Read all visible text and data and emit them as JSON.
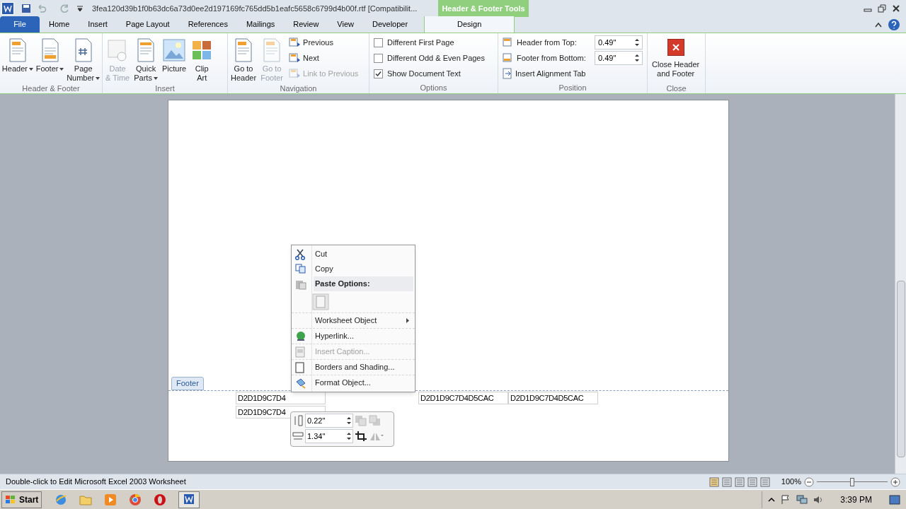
{
  "title_bar": {
    "title": "3fea120d39b1f0b63dc6a73d0ee2d197169fc765dd5b1eafc5658c6799d4b00f.rtf [Compatibilit...",
    "contextual_title": "Header & Footer Tools"
  },
  "tabs": [
    {
      "label": "File",
      "kind": "file",
      "selected": false
    },
    {
      "label": "Home",
      "kind": "tab",
      "selected": false
    },
    {
      "label": "Insert",
      "kind": "tab",
      "selected": false
    },
    {
      "label": "Page Layout",
      "kind": "tab",
      "selected": false
    },
    {
      "label": "References",
      "kind": "tab",
      "selected": false
    },
    {
      "label": "Mailings",
      "kind": "tab",
      "selected": false
    },
    {
      "label": "Review",
      "kind": "tab",
      "selected": false
    },
    {
      "label": "View",
      "kind": "tab",
      "selected": false
    },
    {
      "label": "Developer",
      "kind": "tab",
      "selected": false
    },
    {
      "label": "Design",
      "kind": "contextual",
      "selected": true
    }
  ],
  "groups": [
    {
      "label": "Header & Footer",
      "items": [
        {
          "kind": "large",
          "lines": [
            "Header"
          ],
          "dropdown": true,
          "disabled": false
        },
        {
          "kind": "large",
          "lines": [
            "Footer"
          ],
          "dropdown": true,
          "disabled": false
        },
        {
          "kind": "large",
          "lines": [
            "Page",
            "Number"
          ],
          "dropdown": true,
          "disabled": false
        }
      ]
    },
    {
      "label": "Insert",
      "items": [
        {
          "kind": "large",
          "lines": [
            "Date",
            "& Time"
          ],
          "dropdown": false,
          "disabled": true
        },
        {
          "kind": "large",
          "lines": [
            "Quick",
            "Parts"
          ],
          "dropdown": true,
          "disabled": false
        },
        {
          "kind": "large",
          "lines": [
            "Picture"
          ],
          "dropdown": false,
          "disabled": false
        },
        {
          "kind": "large",
          "lines": [
            "Clip",
            "Art"
          ],
          "dropdown": false,
          "disabled": false
        }
      ]
    },
    {
      "label": "Navigation",
      "items": [
        {
          "kind": "large",
          "lines": [
            "Go to",
            "Header"
          ],
          "dropdown": false,
          "disabled": false
        },
        {
          "kind": "large",
          "lines": [
            "Go to",
            "Footer"
          ],
          "dropdown": false,
          "disabled": true
        },
        {
          "kind": "stack",
          "rows": [
            {
              "label": "Previous",
              "disabled": false
            },
            {
              "label": "Next",
              "disabled": false
            },
            {
              "label": "Link to Previous",
              "disabled": true
            }
          ]
        }
      ]
    },
    {
      "label": "Options",
      "items": [
        {
          "kind": "checks",
          "rows": [
            {
              "label": "Different First Page",
              "checked": false
            },
            {
              "label": "Different Odd & Even Pages",
              "checked": false
            },
            {
              "label": "Show Document Text",
              "checked": true
            }
          ]
        }
      ]
    },
    {
      "label": "Position",
      "items": [
        {
          "kind": "position",
          "rows": [
            {
              "label": "Header from Top:",
              "value": "0.49\""
            },
            {
              "label": "Footer from Bottom:",
              "value": "0.49\""
            }
          ],
          "action": "Insert Alignment Tab"
        }
      ]
    },
    {
      "label": "Close",
      "items": [
        {
          "kind": "close",
          "lines": [
            "Close Header",
            "and Footer"
          ]
        }
      ]
    }
  ],
  "document": {
    "footer_tab": "Footer",
    "footer_rows": [
      [
        "D2D1D9C7D4",
        "D2D1D9C7D4D5CAC",
        "D2D1D9C7D4D5CAC"
      ],
      [
        "D2D1D9C7D4"
      ]
    ]
  },
  "context_menu": [
    {
      "kind": "item",
      "label": "Cut",
      "disabled": false,
      "submenu": false
    },
    {
      "kind": "item",
      "label": "Copy",
      "disabled": false,
      "submenu": false
    },
    {
      "kind": "header",
      "label": "Paste Options:"
    },
    {
      "kind": "paste"
    },
    {
      "kind": "item",
      "label": "Worksheet Object",
      "disabled": false,
      "submenu": true
    },
    {
      "kind": "item",
      "label": "Hyperlink...",
      "disabled": false,
      "submenu": false
    },
    {
      "kind": "item",
      "label": "Insert Caption...",
      "disabled": true,
      "submenu": false
    },
    {
      "kind": "item",
      "label": "Borders and Shading...",
      "disabled": false,
      "submenu": false
    },
    {
      "kind": "item",
      "label": "Format Object...",
      "disabled": false,
      "submenu": false
    }
  ],
  "mini_toolbar": {
    "height": "0.22\"",
    "width": "1.34\""
  },
  "status_bar": {
    "text": "Double-click to Edit Microsoft Excel 2003 Worksheet",
    "zoom": "100%",
    "zoom_slider": {
      "level": 0.5
    }
  },
  "taskbar": {
    "start": "Start",
    "clock": "3:39 PM"
  }
}
